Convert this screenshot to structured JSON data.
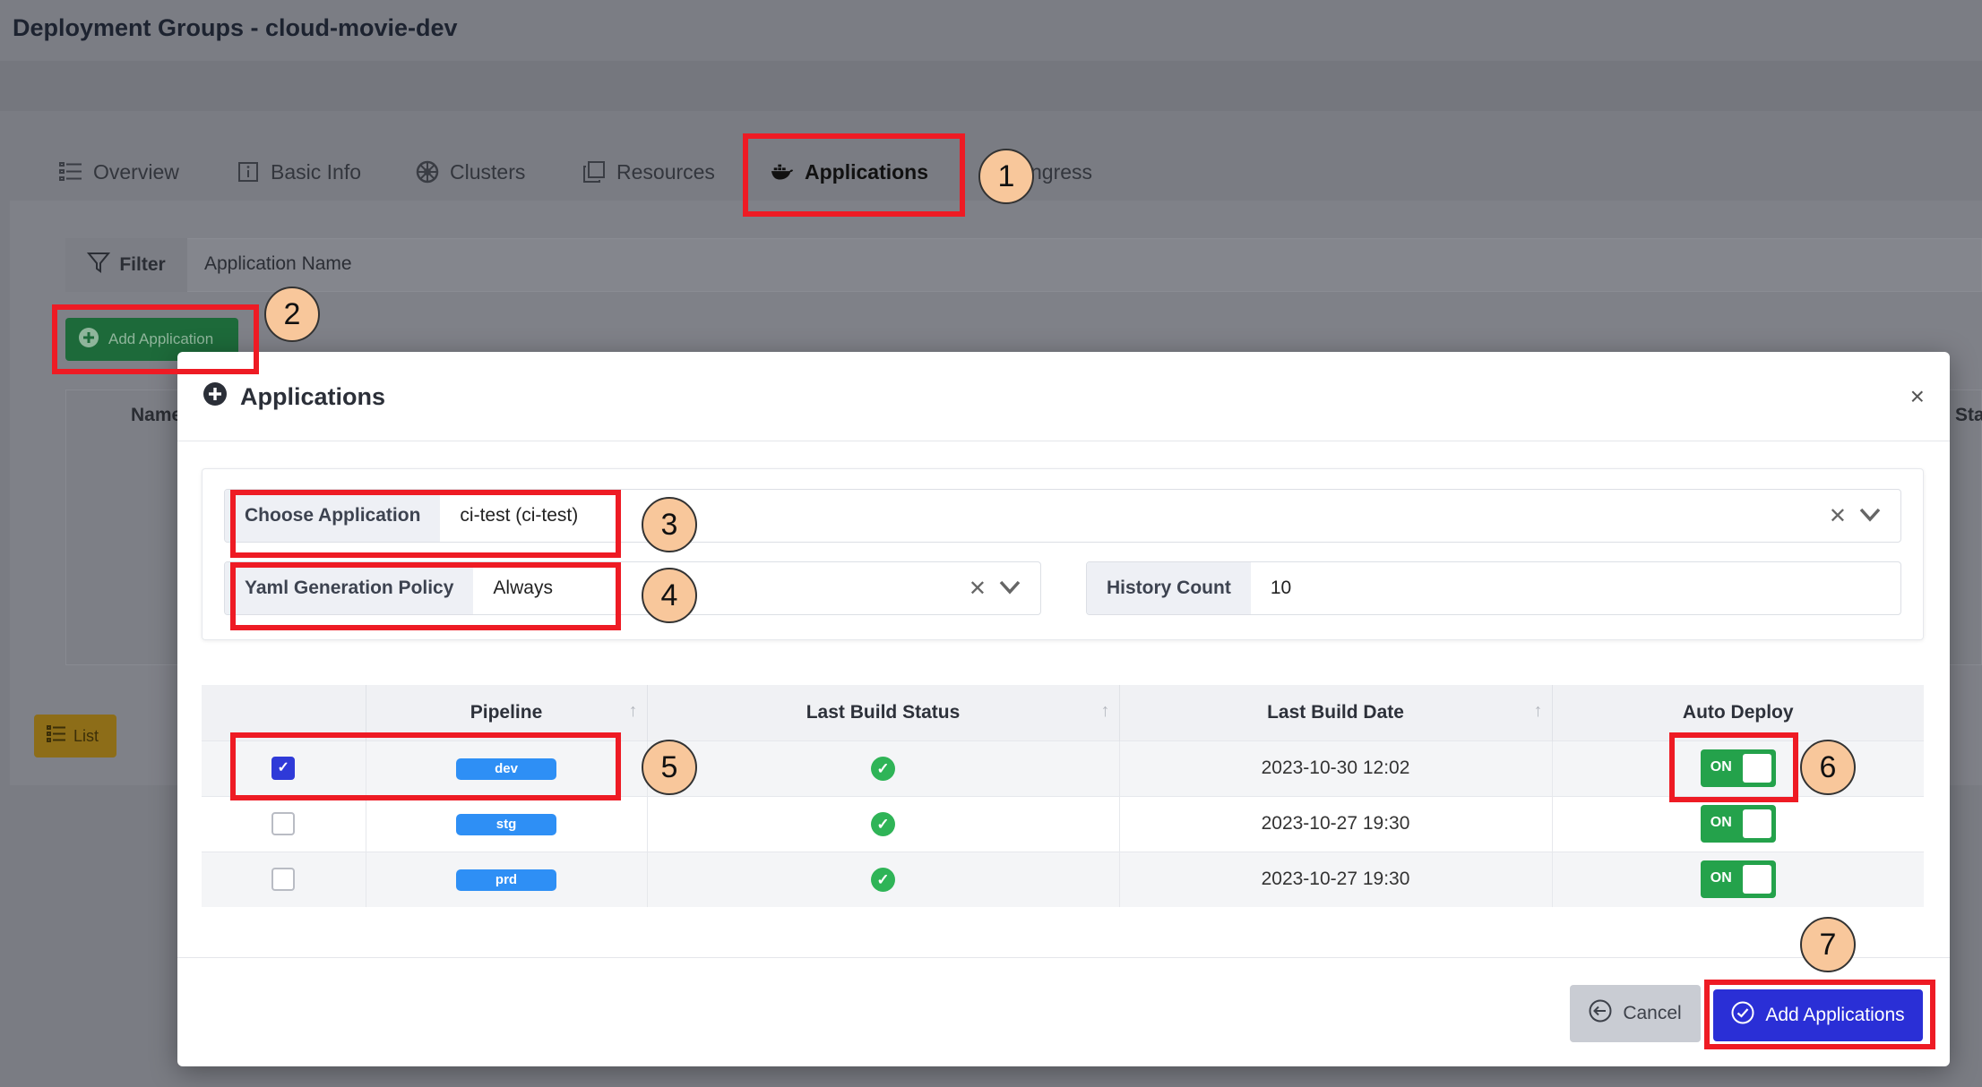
{
  "page": {
    "title": "Deployment Groups - cloud-movie-dev",
    "tabs": [
      {
        "label": "Overview"
      },
      {
        "label": "Basic Info"
      },
      {
        "label": "Clusters"
      },
      {
        "label": "Resources"
      },
      {
        "label": "Applications"
      },
      {
        "label": "ngress"
      }
    ],
    "filter_label": "Filter",
    "filter_placeholder": "Application Name",
    "add_application_label": "Add Application",
    "table_name_header": "Name",
    "table_status_header": "Sta",
    "list_label": "List"
  },
  "modal": {
    "title": "Applications",
    "close": "×",
    "choose_application_label": "Choose Application",
    "choose_application_value": "ci-test (ci-test)",
    "yaml_policy_label": "Yaml Generation Policy",
    "yaml_policy_value": "Always",
    "history_count_label": "History Count",
    "history_count_value": "10",
    "columns": [
      "",
      "Pipeline",
      "Last Build Status",
      "Last Build Date",
      "Auto Deploy"
    ],
    "rows": [
      {
        "checked": true,
        "pipeline": "dev",
        "date": "2023-10-30 12:02",
        "auto_deploy": "ON"
      },
      {
        "checked": false,
        "pipeline": "stg",
        "date": "2023-10-27 19:30",
        "auto_deploy": "ON"
      },
      {
        "checked": false,
        "pipeline": "prd",
        "date": "2023-10-27 19:30",
        "auto_deploy": "ON"
      }
    ],
    "cancel_label": "Cancel",
    "submit_label": "Add Applications"
  },
  "annotations": [
    "1",
    "2",
    "3",
    "4",
    "5",
    "6",
    "7"
  ],
  "colors": {
    "highlight": "#ee1b24",
    "marker": "#f8c79b",
    "primary": "#2a2fd6",
    "toggle_on": "#24a24b",
    "badge": "#2e8ff5"
  }
}
